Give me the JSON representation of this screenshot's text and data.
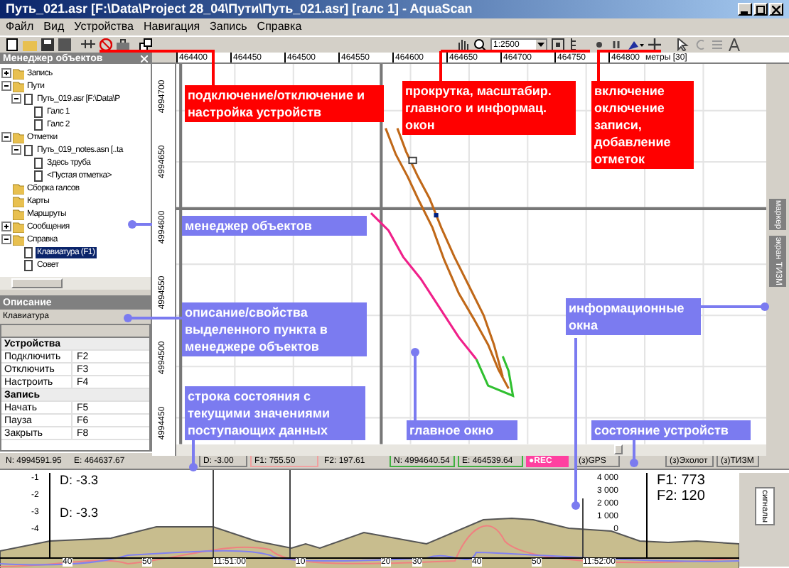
{
  "window": {
    "title": "Путь_021.asr [F:\\Data\\Project 28_04\\Пути\\Путь_021.asr] [галс 1] - AquaScan"
  },
  "menu": [
    "Файл",
    "Вид",
    "Устройства",
    "Навигация",
    "Запись",
    "Справка"
  ],
  "toolbar": {
    "scale": "1:2500"
  },
  "object_manager": {
    "title": "Менеджер объектов",
    "tree": [
      {
        "label": "Запись",
        "expanded": false,
        "selected": false
      },
      {
        "label": "Пути",
        "expanded": true,
        "selected": false,
        "children": [
          {
            "label": "Путь_019.asr [F:\\Data\\P",
            "expanded": true,
            "selected": false,
            "children": [
              {
                "label": "Галс 1",
                "selected": false
              },
              {
                "label": "Галс 2",
                "selected": false
              }
            ]
          }
        ]
      },
      {
        "label": "Отметки",
        "expanded": true,
        "selected": false,
        "children": [
          {
            "label": "Путь_019_notes.asn [..ta",
            "expanded": true,
            "selected": false,
            "children": [
              {
                "label": "Здесь труба",
                "selected": false
              },
              {
                "label": "<Пустая отметка>",
                "selected": false
              }
            ]
          }
        ]
      },
      {
        "label": "Сборка галсов",
        "selected": false
      },
      {
        "label": "Карты",
        "selected": false
      },
      {
        "label": "Маршруты",
        "selected": false
      },
      {
        "label": "Сообщения",
        "expanded": false,
        "selected": false
      },
      {
        "label": "Справка",
        "expanded": true,
        "selected": false,
        "children": [
          {
            "label": "Клавиатура (F1)",
            "selected": true
          },
          {
            "label": "Совет",
            "selected": false
          }
        ]
      }
    ]
  },
  "description": {
    "title": "Описание",
    "item": "Клавиатура",
    "rows": [
      {
        "kind": "group",
        "label": "Устройства"
      },
      {
        "kind": "key",
        "label": "Подключить",
        "key": "F2"
      },
      {
        "kind": "key",
        "label": "Отключить",
        "key": "F3"
      },
      {
        "kind": "key",
        "label": "Настроить",
        "key": "F4"
      },
      {
        "kind": "group",
        "label": "Запись"
      },
      {
        "kind": "key",
        "label": "Начать",
        "key": "F5"
      },
      {
        "kind": "key",
        "label": "Пауза",
        "key": "F6"
      },
      {
        "kind": "key",
        "label": "Закрыть",
        "key": "F8"
      }
    ]
  },
  "map": {
    "x_ruler": [
      "464400",
      "464450",
      "464500",
      "464550",
      "464600",
      "464650",
      "464700",
      "464750",
      "464800"
    ],
    "x_unit": "метры [30]",
    "y_ruler": [
      "4994700",
      "4994650",
      "4994600",
      "4994550",
      "4994500",
      "4994450"
    ],
    "side_tabs": [
      "маркер",
      "экран ТИЗМ"
    ]
  },
  "annotations": [
    {
      "kind": "red",
      "text": "подключение/отключение и настройка устройств"
    },
    {
      "kind": "red",
      "text": "прокрутка, масштабир. главного и информац. окон"
    },
    {
      "kind": "red",
      "text": "включение оключение записи, добавление отметок"
    },
    {
      "kind": "blue",
      "text": "менеджер объектов"
    },
    {
      "kind": "blue",
      "text": "описание/свойства выделенного пункта в менеджере объектов"
    },
    {
      "kind": "blue",
      "text": "строка состояния с текущими значениями поступающих данных"
    },
    {
      "kind": "blue",
      "text": "информационные окна"
    },
    {
      "kind": "blue",
      "text": "главное окно"
    },
    {
      "kind": "blue",
      "text": "состояние устройств"
    }
  ],
  "status_bar": [
    {
      "kind": "plain",
      "text": "N: 4994591.95"
    },
    {
      "kind": "plain",
      "text": "E: 464637.67"
    },
    {
      "kind": "box",
      "text": "D: -3.00"
    },
    {
      "kind": "pink",
      "text": "F1: 755.50"
    },
    {
      "kind": "plain",
      "text": "F2: 197.61"
    },
    {
      "kind": "green",
      "text": "N: 4994640.54"
    },
    {
      "kind": "green",
      "text": "E: 464539.64"
    },
    {
      "kind": "rec",
      "text": "●REC"
    },
    {
      "kind": "box",
      "text": "(з)GPS"
    },
    {
      "kind": "box",
      "text": "(з)Эхолот"
    },
    {
      "kind": "box",
      "text": "(з)ТИЗМ"
    }
  ],
  "signal_panel": {
    "depth_labels": [
      "D: -3.3",
      "D: -3.3"
    ],
    "left_ticks": [
      "-1",
      "-2",
      "-3",
      "-4"
    ],
    "right_ticks": [
      "4 000",
      "3 000",
      "2 000",
      "1 000",
      "0"
    ],
    "readings": [
      "F1: 773",
      "F2: 120"
    ],
    "time_labels": [
      "40",
      "50",
      "11:51:00",
      "10",
      "20",
      "30",
      "40",
      "50",
      "11:52:00"
    ],
    "side_tabs": [
      "сигналы"
    ]
  }
}
